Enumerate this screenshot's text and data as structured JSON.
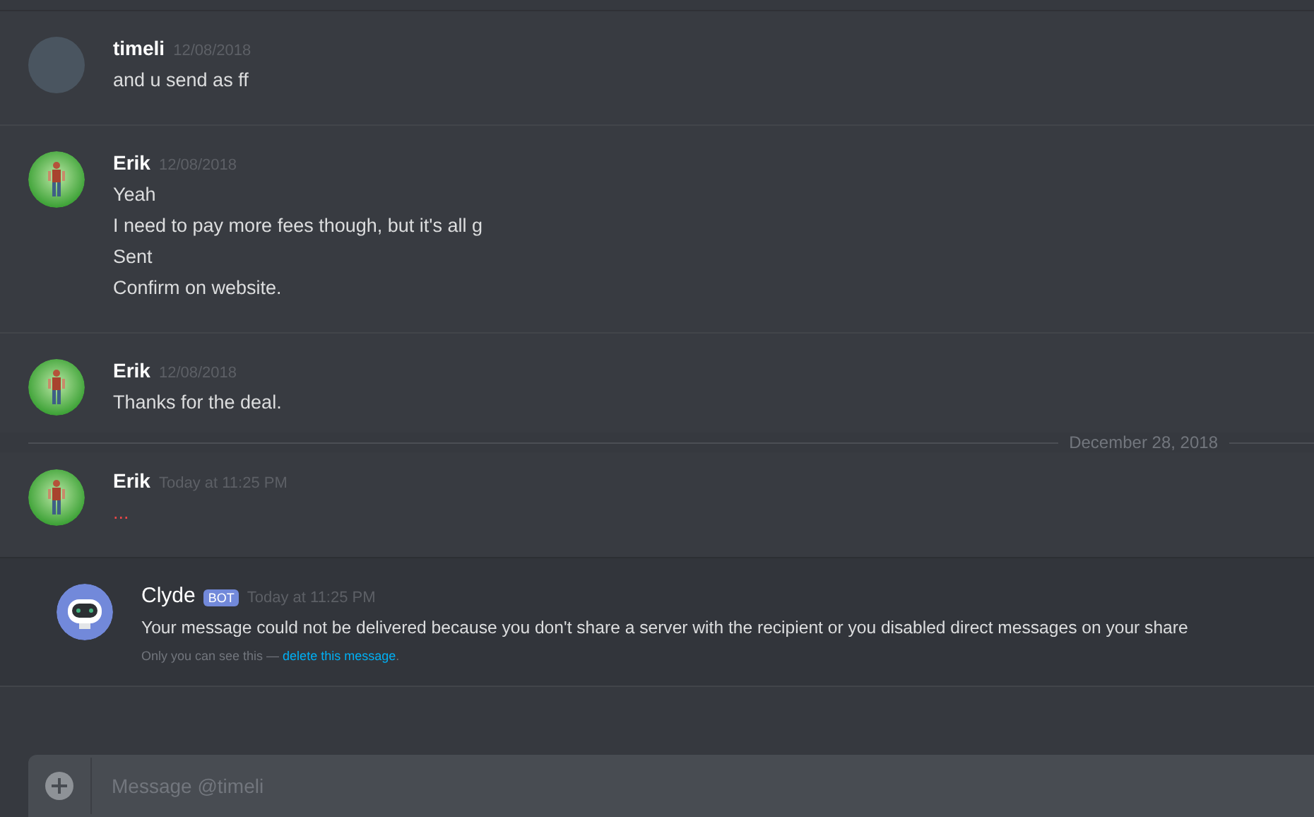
{
  "items": [
    {
      "kind": "message",
      "avatar": {
        "kind": "photo"
      },
      "author": "timeli",
      "timestamp": "12/08/2018",
      "failed": false,
      "lines": [
        "and u send as ff"
      ]
    },
    {
      "kind": "message",
      "avatar": {
        "kind": "character"
      },
      "author": "Erik",
      "timestamp": "12/08/2018",
      "failed": false,
      "lines": [
        "Yeah",
        "I need to pay more fees though, but it's all g",
        "Sent",
        "Confirm on website."
      ]
    },
    {
      "kind": "message",
      "avatar": {
        "kind": "character"
      },
      "author": "Erik",
      "timestamp": "12/08/2018",
      "failed": false,
      "lines": [
        "Thanks for the deal."
      ]
    },
    {
      "kind": "date_divider",
      "label": "December 28, 2018"
    },
    {
      "kind": "message",
      "avatar": {
        "kind": "character"
      },
      "author": "Erik",
      "timestamp": "Today at 11:25 PM",
      "failed": true,
      "lines": [
        "..."
      ]
    },
    {
      "kind": "bot_message",
      "avatar": {
        "kind": "bot"
      },
      "author": "Clyde",
      "badge": "BOT",
      "timestamp": "Today at 11:25 PM",
      "lines": [
        "Your message could not be delivered because you don't share a server with the recipient or you disabled direct messages on your share"
      ],
      "note": "Only you can see this — ",
      "link": "delete this message",
      "note_end": "."
    }
  ],
  "composer": {
    "placeholder": "Message @timeli"
  }
}
